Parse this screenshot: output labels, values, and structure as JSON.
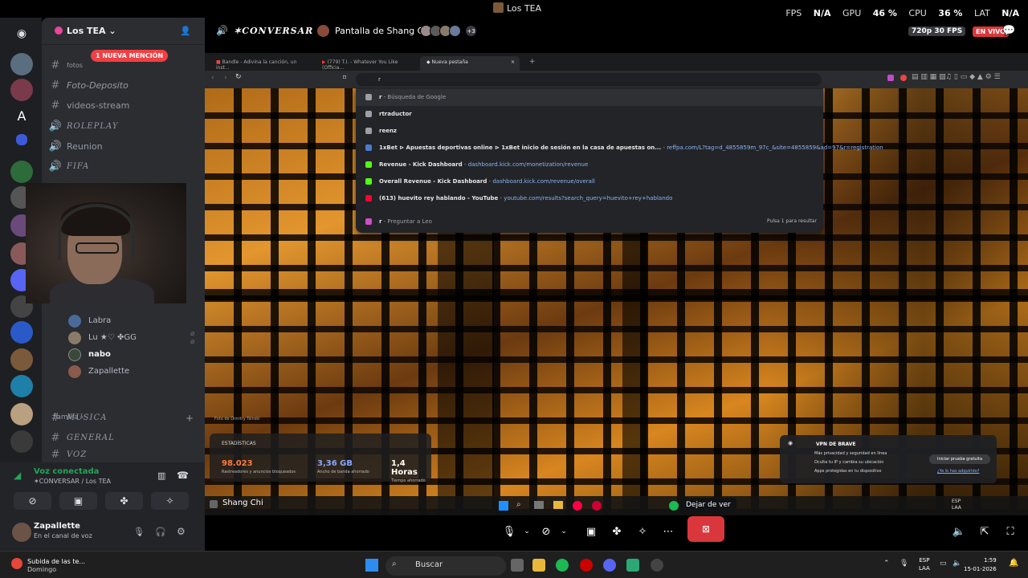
{
  "window": {
    "title": "Los TEA"
  },
  "perf": {
    "fps_label": "FPS",
    "fps_value": "N/A",
    "gpu_label": "GPU",
    "gpu_value": "46 %",
    "cpu_label": "CPU",
    "cpu_value": "36 %",
    "lat_label": "LAT",
    "lat_value": "N/A"
  },
  "server": {
    "name": "Los TEA"
  },
  "mention_badge": "1 NUEVA MENCIÓN",
  "channels": [
    {
      "name": "fotos",
      "type": "text"
    },
    {
      "name": "Foto-Deposito",
      "type": "text"
    },
    {
      "name": "videos-stream",
      "type": "text"
    },
    {
      "name": "ROLEPLAY",
      "type": "voice"
    },
    {
      "name": "Reunion",
      "type": "voice"
    },
    {
      "name": "FIFA",
      "type": "voice"
    }
  ],
  "voice_users": [
    {
      "name": "Labra"
    },
    {
      "name": "Lu ★♡  ✤GG"
    },
    {
      "name": "nabo"
    },
    {
      "name": "Zapallette"
    }
  ],
  "category_familia": "Familia",
  "familia_channels": [
    {
      "name": "MUSICA"
    },
    {
      "name": "GENERAL"
    },
    {
      "name": "VOZ"
    }
  ],
  "voice_panel": {
    "status": "Voz conectada",
    "channel": "✶CONVERSAR / Los TEA"
  },
  "user": {
    "name": "Zapallette",
    "status": "En el canal de voz"
  },
  "stream_header": {
    "channel": "✶CONVERSAR",
    "stream_title": "Pantalla de Shang Chi",
    "more_count": "+3",
    "quality": "720p 30 FPS",
    "live": "EN VIVO"
  },
  "browser": {
    "tabs": [
      {
        "title": "Bandle - Adivina la canción, un inst..."
      },
      {
        "title": "(779) T.I. - Whatever You Like (Officia..."
      },
      {
        "title": "Nueva pestaña"
      }
    ],
    "url_text": "r",
    "suggestions": [
      {
        "text": "r",
        "suffix": " - Búsqueda de Google",
        "url": "",
        "color": "#9aa0a6"
      },
      {
        "text": "rtraductor",
        "suffix": "",
        "url": "",
        "color": "#9aa0a6"
      },
      {
        "text": "reenz",
        "suffix": "",
        "url": "",
        "color": "#9aa0a6"
      },
      {
        "text": "1xBet ⊳ Apuestas deportivas online ⊳ 1xBet inicio de sesión en la casa de apuestas on...",
        "suffix": " - ",
        "url": "reffpa.com/L?tag=d_4855859m_97c_&site=4855859&ad=97&r=registration",
        "color": "#4a7bd0"
      },
      {
        "text": "Revenue - Kick Dashboard",
        "suffix": " - ",
        "url": "dashboard.kick.com/monetization/revenue",
        "color": "#53fc18"
      },
      {
        "text": "Overall Revenue - Kick Dashboard",
        "suffix": " - ",
        "url": "dashboard.kick.com/revenue/overall",
        "color": "#53fc18"
      },
      {
        "text": "(613) huevito rey hablando - YouTube",
        "suffix": " - ",
        "url": "youtube.com/results?search_query=huevito+rey+hablando",
        "color": "#ff0033"
      },
      {
        "text": "r",
        "suffix": " - Preguntar a Leo",
        "url": "",
        "color": "#d14dc7"
      }
    ],
    "omni_hint": "Pulsa 1 para resultar",
    "photo_credit": "Foto de Dimitry Tsinski",
    "stats": {
      "label": "ESTADÍSTICAS",
      "items": [
        {
          "value": "98.023",
          "desc": "Rastreadores y anuncios bloqueados",
          "color": "#ff7b3d"
        },
        {
          "value": "3,36 GB",
          "desc": "Ancho de banda ahorrado",
          "color": "#8aa8ff"
        },
        {
          "value": "1,4 Horas",
          "desc": "Tiempo ahorrado",
          "color": "#ffffff"
        }
      ]
    },
    "vpn": {
      "title": "VPN DE BRAVE",
      "lines": [
        "Más privacidad y seguridad en línea",
        "Oculta tu IP y cambia su ubicación",
        "Apps protegidas en tu dispositivo"
      ],
      "button": "Iniciar prueba gratuita",
      "link": "¿Ya lo has adquirido?"
    },
    "taskbar_label": "Shang Chi"
  },
  "controls": {
    "leave_tooltip": "Dejar de ver"
  },
  "os_taskbar": {
    "weather_title": "Subida de las te...",
    "weather_sub": "Domingo",
    "search_placeholder": "Buscar",
    "lang_top": "ESP",
    "lang_bottom": "LAA",
    "time": "1:59",
    "date": "15-01-2026"
  },
  "colors": {
    "accent_red": "#da373c",
    "voice_green": "#23a55a",
    "mention_red": "#f23f43"
  }
}
